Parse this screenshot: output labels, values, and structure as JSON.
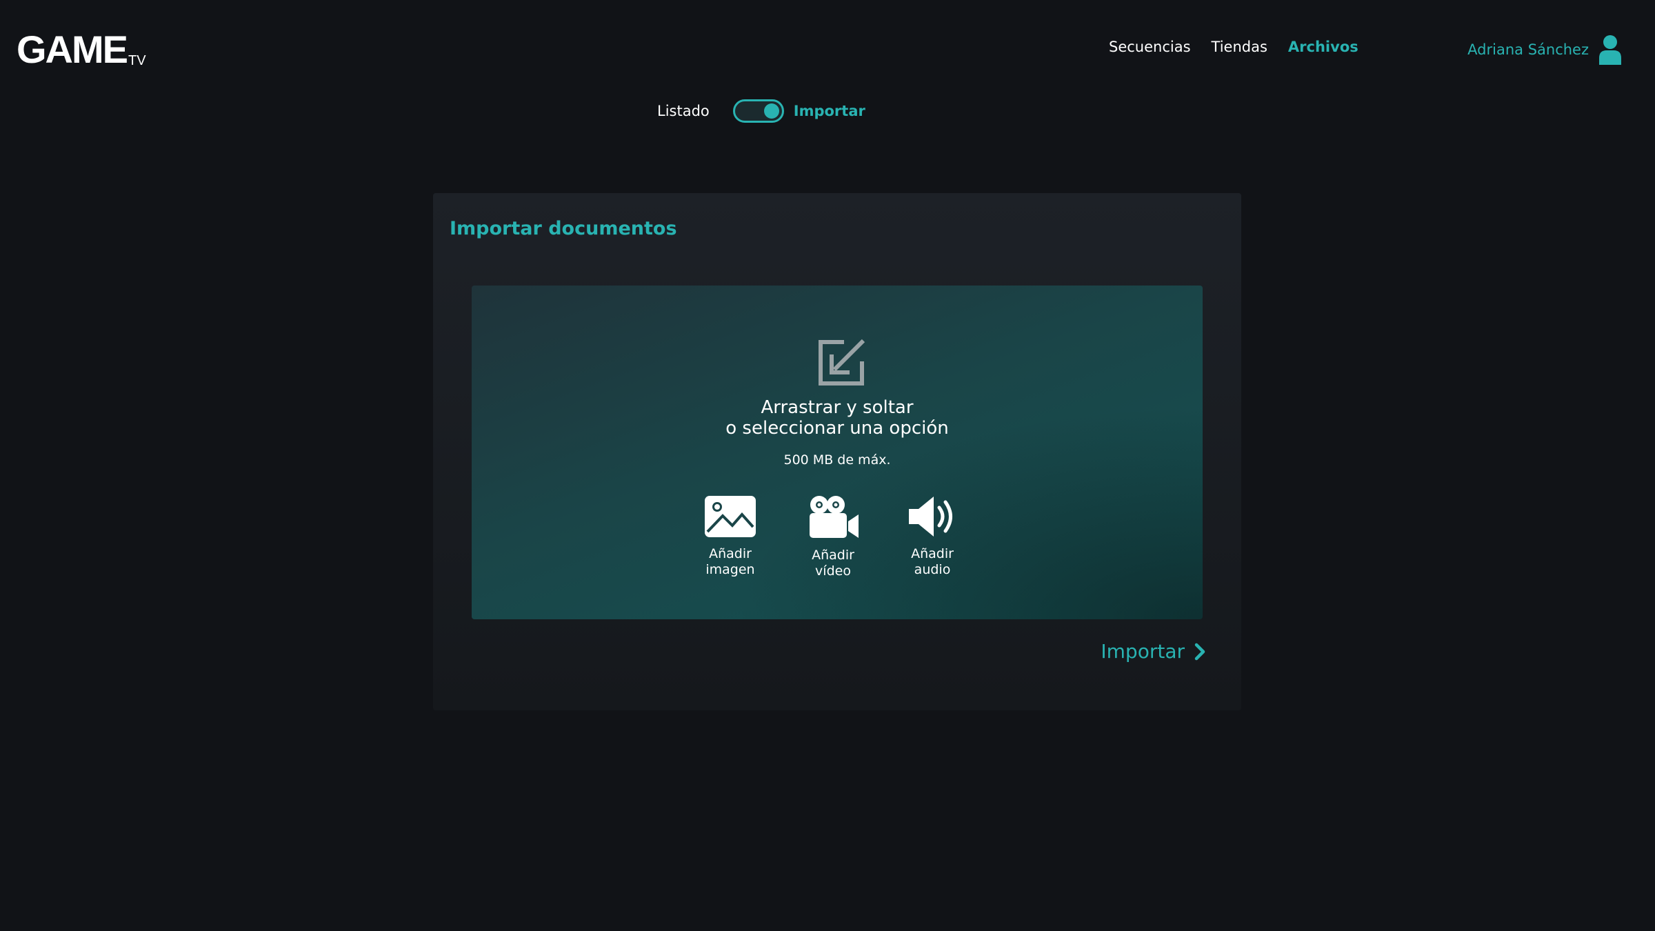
{
  "brand": {
    "logo_main": "GAME",
    "logo_sub": "TV"
  },
  "nav": {
    "items": [
      {
        "label": "Secuencias",
        "active": false
      },
      {
        "label": "Tiendas",
        "active": false
      },
      {
        "label": "Archivos",
        "active": true
      }
    ]
  },
  "user": {
    "name": "Adriana Sánchez",
    "icon": "user-icon"
  },
  "view_toggle": {
    "left_label": "Listado",
    "right_label": "Importar",
    "selected": "Importar"
  },
  "import_card": {
    "title": "Importar documentos",
    "dropzone": {
      "icon": "import-arrow-icon",
      "title_line1": "Arrastrar y soltar",
      "title_line2": "o seleccionar una opción",
      "size_limit": "500 MB de máx.",
      "options": [
        {
          "label": "Añadir\nimagen",
          "icon": "image-icon"
        },
        {
          "label": "Añadir\nvídeo",
          "icon": "video-camera-icon"
        },
        {
          "label": "Añadir\naudio",
          "icon": "speaker-icon"
        }
      ]
    },
    "submit_label": "Importar"
  },
  "colors": {
    "accent": "#29b3b2",
    "background": "#111317",
    "card": "#1b1f24"
  }
}
